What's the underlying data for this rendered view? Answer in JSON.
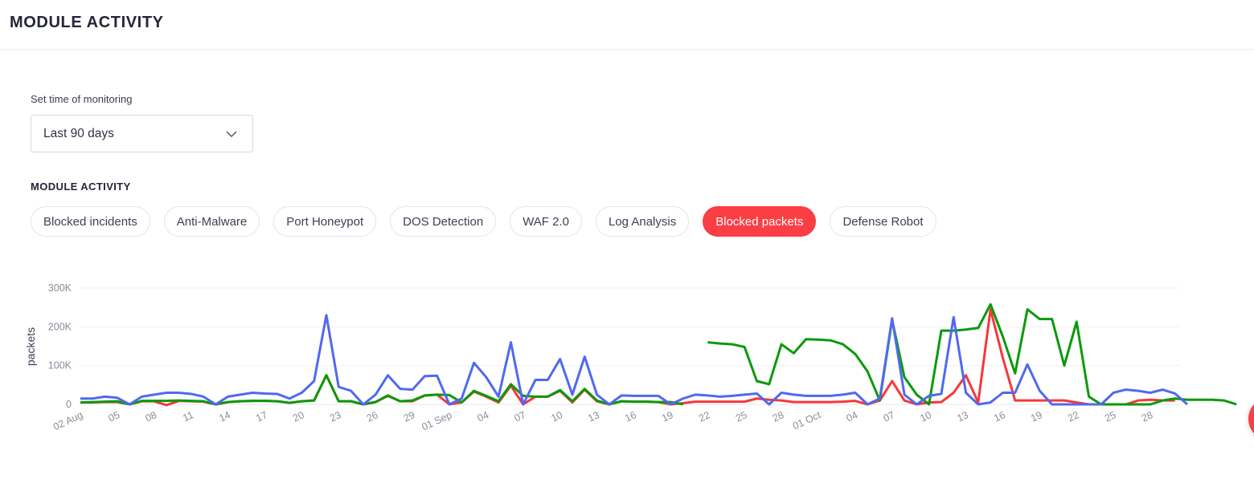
{
  "header": {
    "title": "MODULE ACTIVITY"
  },
  "monitoring": {
    "label": "Set time of monitoring",
    "selected": "Last 90 days",
    "chevron_icon": "chevron-down-icon"
  },
  "section": {
    "title": "MODULE ACTIVITY"
  },
  "tabs": [
    {
      "label": "Blocked incidents",
      "active": false
    },
    {
      "label": "Anti-Malware",
      "active": false
    },
    {
      "label": "Port Honeypot",
      "active": false
    },
    {
      "label": "DOS Detection",
      "active": false
    },
    {
      "label": "WAF 2.0",
      "active": false
    },
    {
      "label": "Log Analysis",
      "active": false
    },
    {
      "label": "Blocked packets",
      "active": true
    },
    {
      "label": "Defense Robot",
      "active": false
    }
  ],
  "colors": {
    "accent": "#fb3d44",
    "blue": "#5069f0",
    "green": "#0a9a0a",
    "red": "#f6373c"
  },
  "chart_data": {
    "type": "line",
    "title": "",
    "xlabel": "",
    "ylabel": "packets",
    "ylim": [
      0,
      300000
    ],
    "yticks": [
      0,
      100000,
      200000,
      300000
    ],
    "ytick_labels": [
      "0",
      "100K",
      "200K",
      "300K"
    ],
    "grid": true,
    "legend": "none",
    "x_start": "02 Aug",
    "x_tick_every": 3,
    "x_tick_labels": [
      "02 Aug",
      "05",
      "08",
      "11",
      "14",
      "17",
      "20",
      "23",
      "26",
      "29",
      "01 Sep",
      "04",
      "07",
      "10",
      "13",
      "16",
      "19",
      "22",
      "25",
      "28",
      "01 Oct",
      "04",
      "07",
      "10",
      "13",
      "16",
      "19",
      "22",
      "25",
      "28"
    ],
    "series": [
      {
        "name": "red",
        "color": "#f6373c",
        "values": [
          5,
          5,
          6,
          6,
          0,
          8,
          8,
          -2,
          9,
          8,
          7,
          0,
          6,
          8,
          9,
          9,
          8,
          4,
          8,
          10,
          75,
          8,
          8,
          0,
          6,
          22,
          8,
          8,
          23,
          25,
          0,
          5,
          33,
          20,
          5,
          48,
          0,
          20,
          20,
          35,
          5,
          38,
          8,
          0,
          8,
          7,
          7,
          6,
          0,
          3,
          7,
          7,
          7,
          7,
          7,
          15,
          12,
          10,
          6,
          6,
          6,
          6,
          7,
          9,
          0,
          10,
          60,
          10,
          0,
          5,
          6,
          30,
          75,
          5,
          245,
          120,
          10,
          10,
          10,
          10,
          10,
          5,
          0,
          0,
          0,
          0,
          10,
          12,
          10,
          10
        ]
      },
      {
        "name": "green",
        "color": "#0a9a0a",
        "values": [
          5,
          6,
          7,
          8,
          0,
          9,
          9,
          9,
          10,
          9,
          8,
          0,
          6,
          8,
          9,
          9,
          8,
          4,
          8,
          10,
          75,
          8,
          8,
          0,
          6,
          23,
          8,
          10,
          23,
          25,
          24,
          5,
          35,
          22,
          8,
          52,
          22,
          20,
          20,
          37,
          8,
          40,
          10,
          0,
          8,
          7,
          7,
          6,
          6,
          0,
          null,
          160,
          157,
          155,
          148,
          60,
          52,
          155,
          132,
          168,
          167,
          165,
          155,
          130,
          85,
          10,
          218,
          70,
          25,
          0,
          190,
          190,
          193,
          197,
          258,
          175,
          80,
          245,
          220,
          220,
          100,
          213,
          20,
          0,
          0,
          0,
          0,
          0,
          10,
          15,
          12,
          12,
          12,
          10,
          0
        ]
      },
      {
        "name": "blue",
        "color": "#5069f0",
        "values": [
          15,
          15,
          20,
          17,
          0,
          20,
          25,
          30,
          30,
          27,
          20,
          0,
          20,
          25,
          30,
          28,
          27,
          15,
          30,
          60,
          230,
          45,
          35,
          0,
          25,
          75,
          40,
          38,
          73,
          74,
          0,
          15,
          107,
          70,
          20,
          160,
          0,
          63,
          63,
          117,
          25,
          123,
          25,
          0,
          23,
          22,
          22,
          22,
          0,
          15,
          25,
          23,
          20,
          22,
          25,
          28,
          0,
          30,
          25,
          22,
          22,
          22,
          25,
          30,
          0,
          15,
          222,
          25,
          0,
          22,
          27,
          225,
          30,
          0,
          5,
          30,
          30,
          103,
          35,
          0,
          0,
          0,
          0,
          0,
          30,
          38,
          35,
          30,
          38,
          28,
          0
        ]
      }
    ]
  }
}
